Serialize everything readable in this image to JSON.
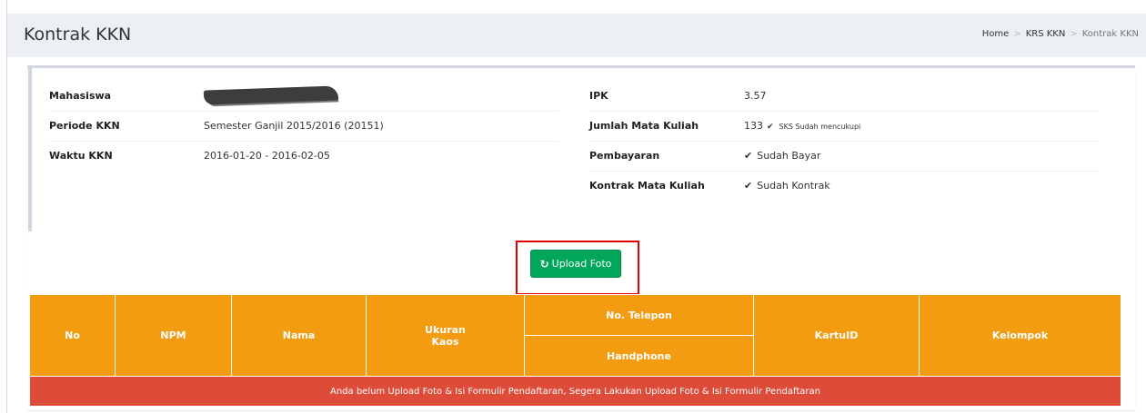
{
  "header": {
    "title": "Kontrak KKN",
    "breadcrumb": [
      "Home",
      "KRS KKN",
      "Kontrak KKN"
    ]
  },
  "left_info": [
    {
      "label": "Mahasiswa",
      "value": ""
    },
    {
      "label": "Periode KKN",
      "value": "Semester Ganjil 2015/2016 (20151)"
    },
    {
      "label": "Waktu KKN",
      "value": "2016-01-20 - 2016-02-05"
    }
  ],
  "right_info": [
    {
      "label": "IPK",
      "value": "3.57"
    },
    {
      "label": "Jumlah Mata Kuliah",
      "value": "133",
      "note": "SKS Sudah mencukupi"
    },
    {
      "label": "Pembayaran",
      "value": "Sudah Bayar"
    },
    {
      "label": "Kontrak Mata Kuliah",
      "value": "Sudah Kontrak"
    }
  ],
  "upload_button": {
    "label": "Upload Foto",
    "icon": "refresh-icon"
  },
  "table": {
    "headers": {
      "no": "No",
      "npm": "NPM",
      "nama": "Nama",
      "ukuran": "Ukuran",
      "kaos": "Kaos",
      "telepon": "No. Telepon",
      "handphone": "Handphone",
      "kartu_id": "KartuID",
      "kelompok": "Kelompok"
    },
    "alert": "Anda belum Upload Foto & Isi Formulir Pendaftaran, Segera Lakukan Upload Foto & Isi Formulir Pendaftaran"
  },
  "colors": {
    "table_header": "#f39c12",
    "alert": "#dd4b39",
    "button": "#00a65a",
    "highlight": "#e00000"
  }
}
